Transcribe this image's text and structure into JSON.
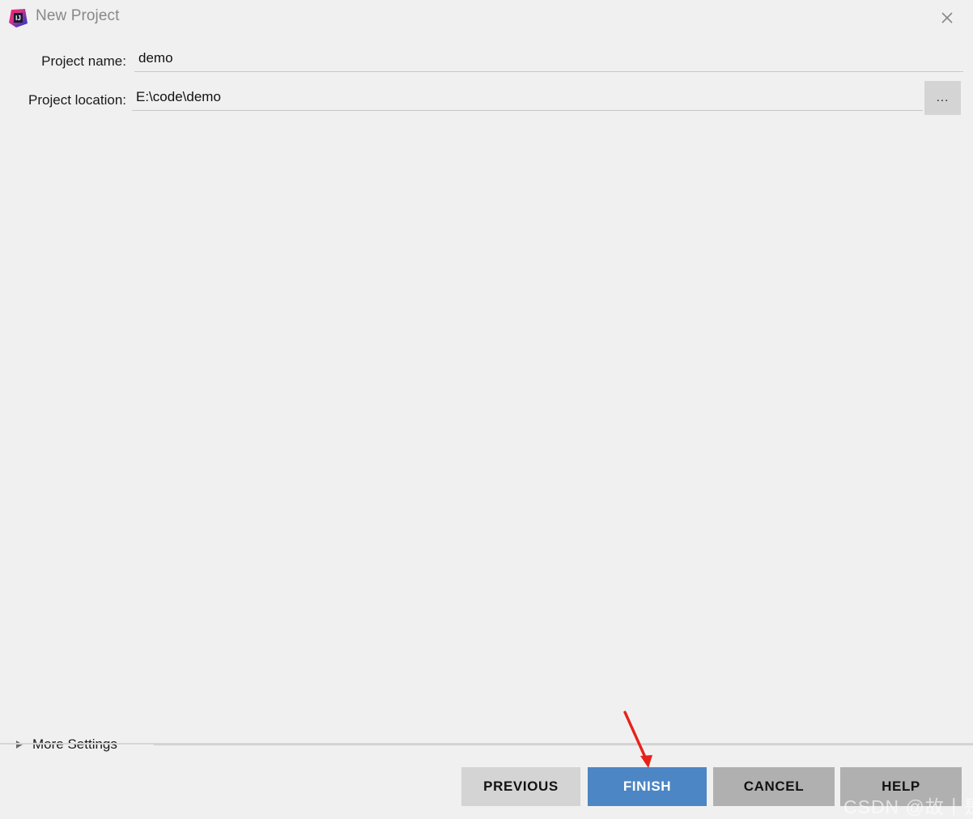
{
  "window": {
    "title": "New Project",
    "app_icon": "intellij-idea-icon",
    "close_icon": "close-icon",
    "background_color": "#f0f0f0",
    "title_color": "#888888"
  },
  "form": {
    "fields": [
      {
        "label": "Project name:",
        "value": "demo",
        "placeholder": "",
        "name": "project-name"
      },
      {
        "label": "Project location:",
        "value": "E:\\code\\demo",
        "placeholder": "",
        "name": "project-location"
      }
    ],
    "browse_button_label": "...",
    "browse_icon": "ellipsis-icon"
  },
  "more_settings": {
    "label": "More Settings",
    "expanded": false,
    "disclosure_icon": "triangle-right-icon"
  },
  "footer": {
    "buttons": [
      {
        "label": "PREVIOUS",
        "name": "previous-button",
        "style": "default",
        "color": "#d4d4d4"
      },
      {
        "label": "FINISH",
        "name": "finish-button",
        "style": "primary",
        "color": "#4d86c4"
      },
      {
        "label": "CANCEL",
        "name": "cancel-button",
        "style": "default",
        "color": "#b0b0b0"
      },
      {
        "label": "HELP",
        "name": "help-button",
        "style": "default",
        "color": "#b0b0b0"
      }
    ]
  },
  "annotation": {
    "arrow_color": "#e01b१b",
    "arrow_target": "finish-button"
  },
  "watermark": {
    "text": "CSDN @故丨是"
  }
}
